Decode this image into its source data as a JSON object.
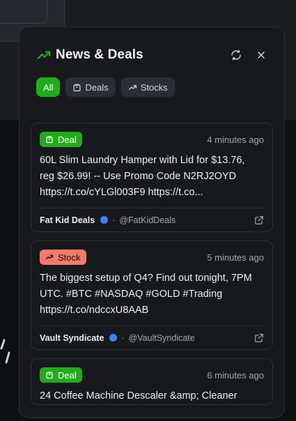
{
  "header": {
    "title": "News & Deals",
    "refresh_icon": "refresh-icon",
    "close_icon": "close-icon"
  },
  "filters": [
    {
      "label": "All",
      "active": true
    },
    {
      "label": "Deals",
      "icon": "bag-icon"
    },
    {
      "label": "Stocks",
      "icon": "trend-icon"
    }
  ],
  "colors": {
    "accent": "#1fae1a",
    "stock_badge": "#f57a6b",
    "verified": "#3b82f6"
  },
  "feed": [
    {
      "type": "Deal",
      "time": "4 minutes ago",
      "text": "60L Slim Laundry Hamper with Lid for $13.76, reg $26.99! -- Use Promo Code N2RJ2OYD https://t.co/cYLGl003F9 https://t.co...",
      "author": "Fat Kid Deals",
      "handle": "@FatKidDeals"
    },
    {
      "type": "Stock",
      "time": "5 minutes ago",
      "text": "The biggest setup of Q4? Find out tonight, 7PM UTC. #BTC #NASDAQ #GOLD #Trading https://t.co/ndccxU8AAB",
      "author": "Vault Syndicate",
      "handle": "@VaultSyndicate"
    },
    {
      "type": "Deal",
      "time": "6 minutes ago",
      "text": "24 Coffee Machine Descaler &amp; Cleaner",
      "author": "",
      "handle": ""
    }
  ]
}
